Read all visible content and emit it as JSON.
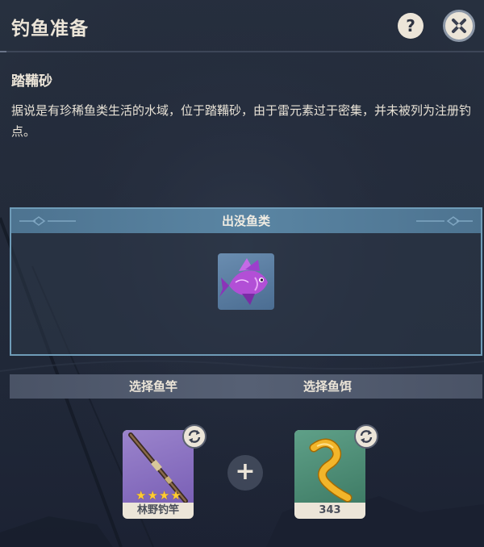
{
  "header": {
    "title": "钓鱼准备",
    "help_label": "?",
    "help_icon": "question-mark-icon",
    "close_icon": "close-x-icon"
  },
  "location": {
    "name": "踏鞴砂",
    "description": "据说是有珍稀鱼类生活的水域，位于踏鞴砂，由于雷元素过于密集，并未被列为注册钓点。"
  },
  "fish_panel": {
    "heading": "出没鱼类",
    "fish": [
      {
        "icon": "purple-fish-icon"
      }
    ]
  },
  "selection": {
    "rod_label": "选择鱼竿",
    "bait_label": "选择鱼饵",
    "plus_symbol": "+",
    "rod": {
      "name": "林野钓竿",
      "stars": 4,
      "icon": "fishing-rod-icon",
      "swap_icon": "swap-icon"
    },
    "bait": {
      "count": "343",
      "icon": "worm-bait-icon",
      "swap_icon": "swap-icon"
    }
  },
  "colors": {
    "accent_blue": "#5a85a3",
    "cream": "#ece5d8",
    "rod_card_bg": "#8a6fc0",
    "bait_card_bg": "#4f8f78",
    "star": "#ffcc32"
  }
}
